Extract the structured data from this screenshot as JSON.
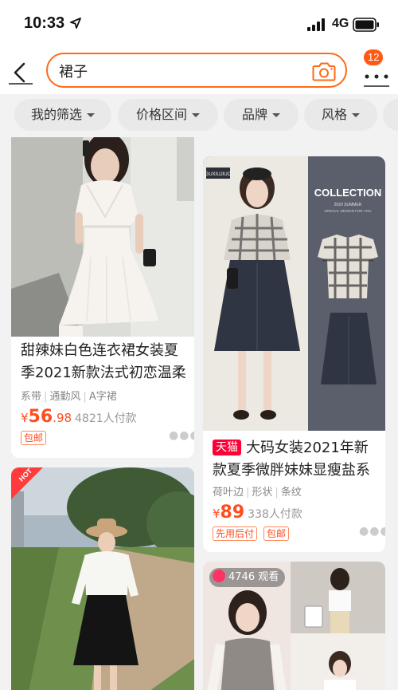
{
  "status_bar": {
    "time": "10:33",
    "network": "4G"
  },
  "search": {
    "query": "裙子",
    "placeholder": ""
  },
  "header": {
    "badge_count": "12"
  },
  "filters": [
    {
      "label": "我的筛选"
    },
    {
      "label": "价格区间"
    },
    {
      "label": "品牌"
    },
    {
      "label": "风格"
    }
  ],
  "products": [
    {
      "title": "甜辣妹白色连衣裙女装夏季2021新款法式初恋温柔",
      "title_line1": "甜辣妹白色连衣裙女装夏",
      "title_line2": "季2021新款法式初恋温柔",
      "tags": [
        "系带",
        "通勤风",
        "A字裙"
      ],
      "price_symbol": "¥",
      "price_int": "56",
      "price_dec": ".98",
      "sold": "4821人付款",
      "pills": [
        "包邮"
      ]
    },
    {
      "shop_badge": "天猫",
      "title_line1": "大码女装2021年新",
      "title_line2": "款夏季微胖妹妹显瘦盐系",
      "tags": [
        "荷叶边",
        "形状",
        "条纹"
      ],
      "price_symbol": "¥",
      "price_int": "89",
      "price_dec": "",
      "sold": "338人付款",
      "pills": [
        "先用后付",
        "包邮"
      ],
      "image_brand": "GUXIUJIUO",
      "image_heading": "COLLECTION",
      "image_subheading": "2020 SUMMER",
      "image_tagline": "SPECIAL DESIGN FOR YOU"
    },
    {
      "hot_label": "HOT"
    },
    {
      "live_count": "4746 观看"
    }
  ],
  "icons": {
    "back": "back-arrow-icon",
    "camera": "camera-icon",
    "more": "more-dots-icon",
    "location": "location-arrow-icon",
    "signal": "signal-icon",
    "battery": "battery-icon"
  },
  "colors": {
    "accent": "#ff6a14",
    "price": "#ff4d1f",
    "tmall": "#ff0036",
    "background": "#f2f2f2"
  }
}
